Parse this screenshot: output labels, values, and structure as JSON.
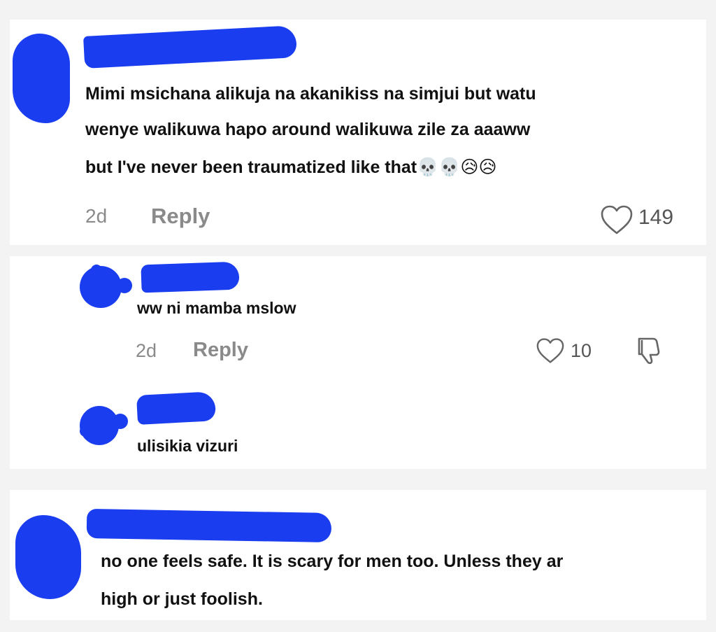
{
  "comments": [
    {
      "text_line1": "Mimi msichana alikuja na akanikiss na simjui but watu",
      "text_line2": "wenye walikuwa hapo around walikuwa zile za aaaww",
      "text_line3": "but I've never been traumatized like that",
      "emojis": "💀💀😥😥",
      "time": "2d",
      "reply_label": "Reply",
      "likes": "149"
    },
    {
      "text": "ww ni mamba mslow",
      "time": "2d",
      "reply_label": "Reply",
      "likes": "10"
    },
    {
      "text": "ulisikia vizuri"
    },
    {
      "text_line1": "no one feels safe. It is scary for men too. Unless they ar",
      "text_line2": "high or just foolish."
    }
  ],
  "colors": {
    "redaction": "#1a3df0",
    "meta_gray": "#8a8a8a"
  }
}
